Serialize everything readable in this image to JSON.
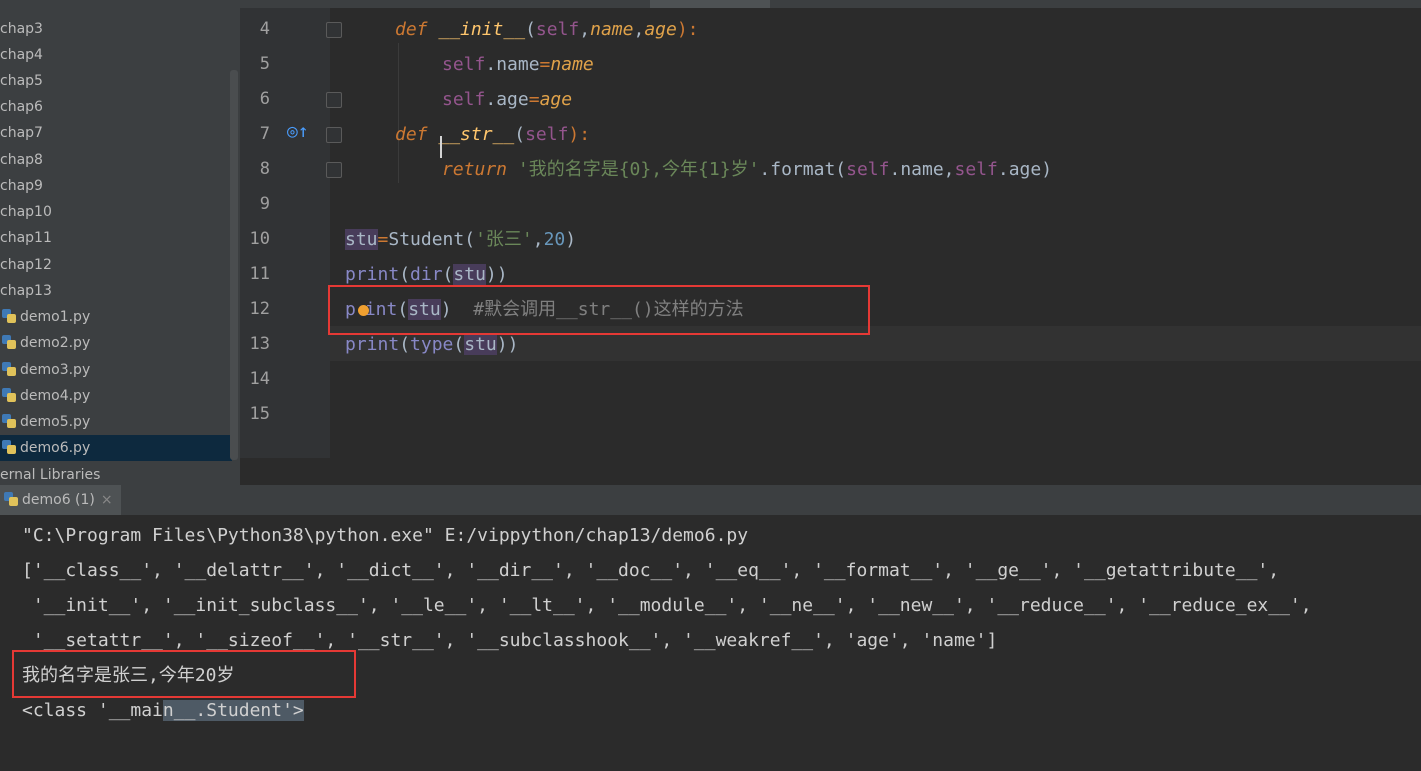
{
  "sidebar": {
    "items": [
      {
        "label": "chap3",
        "type": "folder"
      },
      {
        "label": "chap4",
        "type": "folder"
      },
      {
        "label": "chap5",
        "type": "folder"
      },
      {
        "label": "chap6",
        "type": "folder"
      },
      {
        "label": "chap7",
        "type": "folder"
      },
      {
        "label": "chap8",
        "type": "folder"
      },
      {
        "label": "chap9",
        "type": "folder"
      },
      {
        "label": "chap10",
        "type": "folder"
      },
      {
        "label": "chap11",
        "type": "folder"
      },
      {
        "label": "chap12",
        "type": "folder"
      },
      {
        "label": "chap13",
        "type": "folder"
      },
      {
        "label": "demo1.py",
        "type": "python-file"
      },
      {
        "label": "demo2.py",
        "type": "python-file"
      },
      {
        "label": "demo3.py",
        "type": "python-file"
      },
      {
        "label": "demo4.py",
        "type": "python-file"
      },
      {
        "label": "demo5.py",
        "type": "python-file"
      },
      {
        "label": "demo6.py",
        "type": "python-file",
        "selected": true
      },
      {
        "label": "ernal Libraries",
        "type": "library"
      }
    ]
  },
  "editor": {
    "line_numbers": [
      "4",
      "5",
      "6",
      "7",
      "8",
      "9",
      "10",
      "11",
      "12",
      "13",
      "14",
      "15"
    ],
    "lines": {
      "l4": {
        "kw": "def",
        "name": "__init__",
        "open": "(",
        "self": "self",
        "c1": ",",
        "p1": "name",
        "c2": ",",
        "p2": "age",
        "close": "):"
      },
      "l5": {
        "self": "self",
        "attr": ".name",
        "eq": "=",
        "val": "name"
      },
      "l6": {
        "self": "self",
        "attr": ".age",
        "eq": "=",
        "val": "age"
      },
      "l7": {
        "kw": "def",
        "name": "__str__",
        "open": "(",
        "self": "self",
        "close": "):"
      },
      "l8": {
        "kw": "return",
        "str": "'我的名字是{0},今年{1}岁'",
        "fmt": ".format",
        "open": "(",
        "self1": "self",
        "a1": ".name,",
        "self2": "self",
        "a2": ".age",
        "close": ")"
      },
      "l10": {
        "var": "stu",
        "eq": "=",
        "cls": "Student",
        "open": "(",
        "str": "'张三'",
        "comma": ",",
        "num": "20",
        "close": ")"
      },
      "l11": {
        "f1": "print",
        "o1": "(",
        "f2": "dir",
        "o2": "(",
        "var": "stu",
        "close": "))"
      },
      "l12": {
        "p": "p",
        "rest": "int",
        "o": "(",
        "var": "stu",
        "close": ")",
        "comment": "#默会调用__str__()这样的方法"
      },
      "l13": {
        "f1": "print",
        "o1": "(",
        "f2": "type",
        "o2": "(",
        "var": "stu",
        "close": "))"
      }
    }
  },
  "run_panel": {
    "tab_label": "demo6 (1)",
    "close_glyph": "×",
    "output": [
      "\"C:\\Program Files\\Python38\\python.exe\" E:/vippython/chap13/demo6.py",
      "['__class__', '__delattr__', '__dict__', '__dir__', '__doc__', '__eq__', '__format__', '__ge__', '__getattribute__', ",
      " '__init__', '__init_subclass__', '__le__', '__lt__', '__module__', '__ne__', '__new__', '__reduce__', '__reduce_ex__',",
      " '__setattr__', '__sizeof__', '__str__', '__subclasshook__', '__weakref__', 'age', 'name']",
      "我的名字是张三,今年20岁"
    ],
    "last_line_a": "<class '__mai",
    "last_line_b": "n__.Student'>"
  },
  "colors": {
    "keyword": "#cc7832",
    "function_name": "#ffc66d",
    "self": "#94558d",
    "string": "#6a8759",
    "number": "#6897bb",
    "comment": "#808080",
    "highlight_box": "#e53935"
  }
}
